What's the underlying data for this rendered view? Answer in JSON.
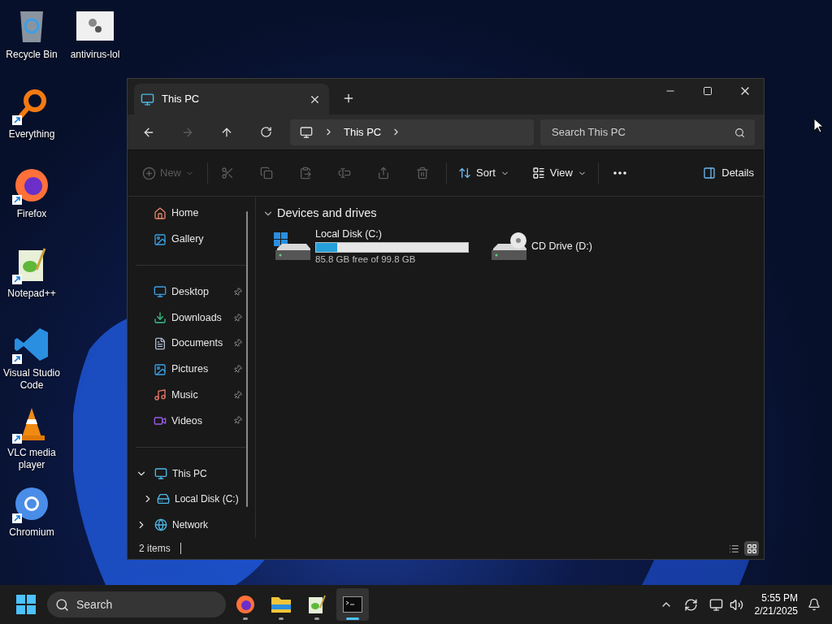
{
  "desktop_icons": [
    {
      "label": "Recycle Bin",
      "shortcut": false
    },
    {
      "label": "antivirus-lol",
      "shortcut": false
    },
    {
      "label": "Everything",
      "shortcut": true
    },
    {
      "label": "Firefox",
      "shortcut": true
    },
    {
      "label": "Notepad++",
      "shortcut": true
    },
    {
      "label": "Visual Studio Code",
      "shortcut": true
    },
    {
      "label": "VLC media player",
      "shortcut": true
    },
    {
      "label": "Chromium",
      "shortcut": true
    }
  ],
  "window": {
    "tabs": [
      {
        "title": "This PC",
        "selected": true
      }
    ],
    "nav": {
      "back_disabled": false,
      "forward_disabled": true
    },
    "address": {
      "breadcrumb": [
        "This PC"
      ]
    },
    "search": {
      "placeholder": "Search This PC"
    },
    "command_bar": {
      "new": {
        "label": "New",
        "disabled": true
      },
      "actions_disabled": true,
      "sort": "Sort",
      "view": "View",
      "details": "Details"
    },
    "sidebar": {
      "quick": [
        {
          "label": "Home",
          "pinned": false
        },
        {
          "label": "Gallery",
          "pinned": false
        }
      ],
      "pinned": [
        {
          "label": "Desktop",
          "pinned": true
        },
        {
          "label": "Downloads",
          "pinned": true
        },
        {
          "label": "Documents",
          "pinned": true
        },
        {
          "label": "Pictures",
          "pinned": true
        },
        {
          "label": "Music",
          "pinned": true
        },
        {
          "label": "Videos",
          "pinned": true
        }
      ],
      "tree": [
        {
          "label": "This PC",
          "expanded": true,
          "children": [
            {
              "label": "Local Disk (C:)",
              "expanded": false
            }
          ]
        },
        {
          "label": "Network",
          "expanded": false
        }
      ]
    },
    "section": {
      "title": "Devices and drives",
      "expanded": true
    },
    "drives": [
      {
        "kind": "disk",
        "name": "Local Disk (C:)",
        "level": 0.14,
        "detail": "85.8 GB free of 99.8 GB"
      },
      {
        "kind": "cd",
        "name": "CD Drive (D:)"
      }
    ],
    "status_bar": {
      "count": "2 items",
      "views": [
        {
          "kind": "details",
          "selected": false
        },
        {
          "kind": "tiles",
          "selected": true
        }
      ]
    }
  },
  "taskbar": {
    "search": {
      "placeholder": "Search"
    },
    "apps": [
      {
        "kind": "firefox",
        "selected": false
      },
      {
        "kind": "explorer",
        "selected": false
      },
      {
        "kind": "notepad",
        "selected": false
      },
      {
        "kind": "terminal",
        "selected": true
      }
    ],
    "time": "5:55 PM",
    "date": "2/21/2025"
  }
}
